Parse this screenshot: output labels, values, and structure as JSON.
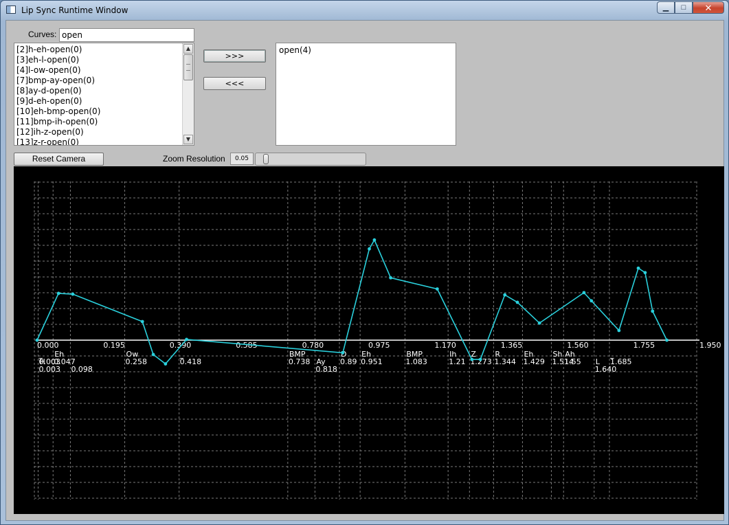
{
  "window": {
    "title": "Lip Sync Runtime Window"
  },
  "caption_buttons": {
    "minimize": "▁",
    "maximize": "□",
    "close": "✕"
  },
  "curves": {
    "label": "Curves:",
    "value": "open"
  },
  "available_curves": [
    "[2]h-eh-open(0)",
    "[3]eh-l-open(0)",
    "[4]l-ow-open(0)",
    "[7]bmp-ay-open(0)",
    "[8]ay-d-open(0)",
    "[9]d-eh-open(0)",
    "[10]eh-bmp-open(0)",
    "[11]bmp-ih-open(0)",
    "[12]ih-z-open(0)",
    "[13]z-r-open(0)"
  ],
  "selected_curves": [
    "open(4)"
  ],
  "buttons": {
    "add": ">>>",
    "remove": "<<<",
    "reset_camera": "Reset Camera"
  },
  "zoom": {
    "label": "Zoom Resolution",
    "value": "0.05",
    "slider_fraction": 0.06
  },
  "chart_data": {
    "type": "line",
    "colors": {
      "line": "#2ad0dc",
      "axis": "#ffffff",
      "grid": "#7a7a7a"
    },
    "xlim": [
      0.0,
      1.95
    ],
    "x_tick_labels": [
      "0.000",
      "0.195",
      "0.390",
      "0.585",
      "0.780",
      "0.975",
      "1.170",
      "1.365",
      "1.560",
      "1.755",
      "1.950"
    ],
    "x_ticks": [
      0.0,
      0.195,
      0.39,
      0.585,
      0.78,
      0.975,
      1.17,
      1.365,
      1.56,
      1.755,
      1.95
    ],
    "series": [
      {
        "points": [
          [
            0.0,
            0.0
          ],
          [
            0.063,
            0.315
          ],
          [
            0.105,
            0.31
          ],
          [
            0.31,
            0.125
          ],
          [
            0.342,
            -0.097
          ],
          [
            0.378,
            -0.16
          ],
          [
            0.44,
            0.005
          ],
          [
            0.9,
            -0.085
          ],
          [
            0.978,
            0.615
          ],
          [
            0.993,
            0.675
          ],
          [
            1.041,
            0.42
          ],
          [
            1.178,
            0.345
          ],
          [
            1.28,
            -0.13
          ],
          [
            1.305,
            -0.13
          ],
          [
            1.377,
            0.305
          ],
          [
            1.414,
            0.255
          ],
          [
            1.479,
            0.115
          ],
          [
            1.61,
            0.32
          ],
          [
            1.632,
            0.265
          ],
          [
            1.713,
            0.065
          ],
          [
            1.77,
            0.485
          ],
          [
            1.79,
            0.455
          ],
          [
            1.812,
            0.195
          ],
          [
            1.854,
            0.0
          ]
        ]
      }
    ],
    "phonemes": [
      {
        "label": "_",
        "x": 0.003,
        "time_label": "0.003",
        "row": 0
      },
      {
        "label": "Eh",
        "x": 0.047,
        "time_label": "0.047",
        "row": 0
      },
      {
        "label": "H",
        "x": 0.003,
        "time_label": "0.003",
        "row": 1
      },
      {
        "label": "",
        "x": 0.098,
        "time_label": "0.098",
        "row": 1
      },
      {
        "label": "Ow",
        "x": 0.258,
        "time_label": "0.258",
        "row": 0
      },
      {
        "label": "_",
        "x": 0.418,
        "time_label": "0.418",
        "row": 0
      },
      {
        "label": "BMP",
        "x": 0.738,
        "time_label": "0.738",
        "row": 0
      },
      {
        "label": "Ay",
        "x": 0.818,
        "time_label": "0.818",
        "row": 1
      },
      {
        "label": "D",
        "x": 0.89,
        "time_label": "0.89",
        "row": 0
      },
      {
        "label": "Eh",
        "x": 0.951,
        "time_label": "0.951",
        "row": 0
      },
      {
        "label": "BMP",
        "x": 1.083,
        "time_label": "1.083",
        "row": 0
      },
      {
        "label": "Ih",
        "x": 1.21,
        "time_label": "1.21",
        "row": 0
      },
      {
        "label": "Z",
        "x": 1.273,
        "time_label": "1.273",
        "row": 0
      },
      {
        "label": "R",
        "x": 1.344,
        "time_label": "1.344",
        "row": 0
      },
      {
        "label": "Eh",
        "x": 1.429,
        "time_label": "1.429",
        "row": 0
      },
      {
        "label": "Sh",
        "x": 1.514,
        "time_label": "1.514",
        "row": 0
      },
      {
        "label": "Ah",
        "x": 1.55,
        "time_label": "1.55",
        "row": 0
      },
      {
        "label": "L",
        "x": 1.64,
        "time_label": "1.640",
        "row": 1
      },
      {
        "label": "_",
        "x": 1.685,
        "time_label": "1.685",
        "row": 0
      }
    ]
  }
}
